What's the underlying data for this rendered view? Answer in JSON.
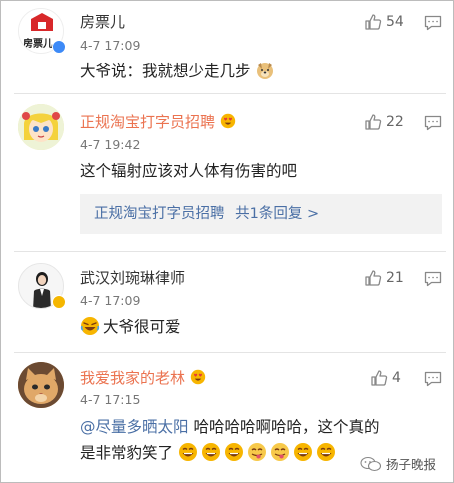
{
  "comments": [
    {
      "name": "房票儿",
      "time": "4-7 17:09",
      "likes": "54",
      "text": "大爷说：我就想少走几步",
      "avatar_text": "房票儿"
    },
    {
      "name": "正规淘宝打字员招聘",
      "time": "4-7 19:42",
      "likes": "22",
      "text": "这个辐射应该对人体有伤害的吧",
      "reply_name": "正规淘宝打字员招聘",
      "reply_summary": "共1条回复 >"
    },
    {
      "name": "武汉刘琬琳律师",
      "time": "4-7 17:09",
      "likes": "21",
      "text": "大爷很可爱"
    },
    {
      "name": "我爱我家的老林",
      "time": "4-7 17:15",
      "likes": "4",
      "mention": "@尽量多晒太阳",
      "text_line1": " 哈哈哈哈啊哈哈，这个真的",
      "text_line2": "是非常豹笑了"
    }
  ],
  "watermark": "扬子晚报",
  "colors": {
    "orange_name": "#eb7350",
    "link_blue": "#4a6fa5",
    "reply_bg": "#f2f2f2"
  },
  "icons": [
    "thumbs-up-icon",
    "message-icon",
    "laughing-emoji",
    "tongue-out-emoji",
    "heart-eyes-emoji",
    "dog-emoji",
    "verified-badge",
    "wechat-icon"
  ]
}
